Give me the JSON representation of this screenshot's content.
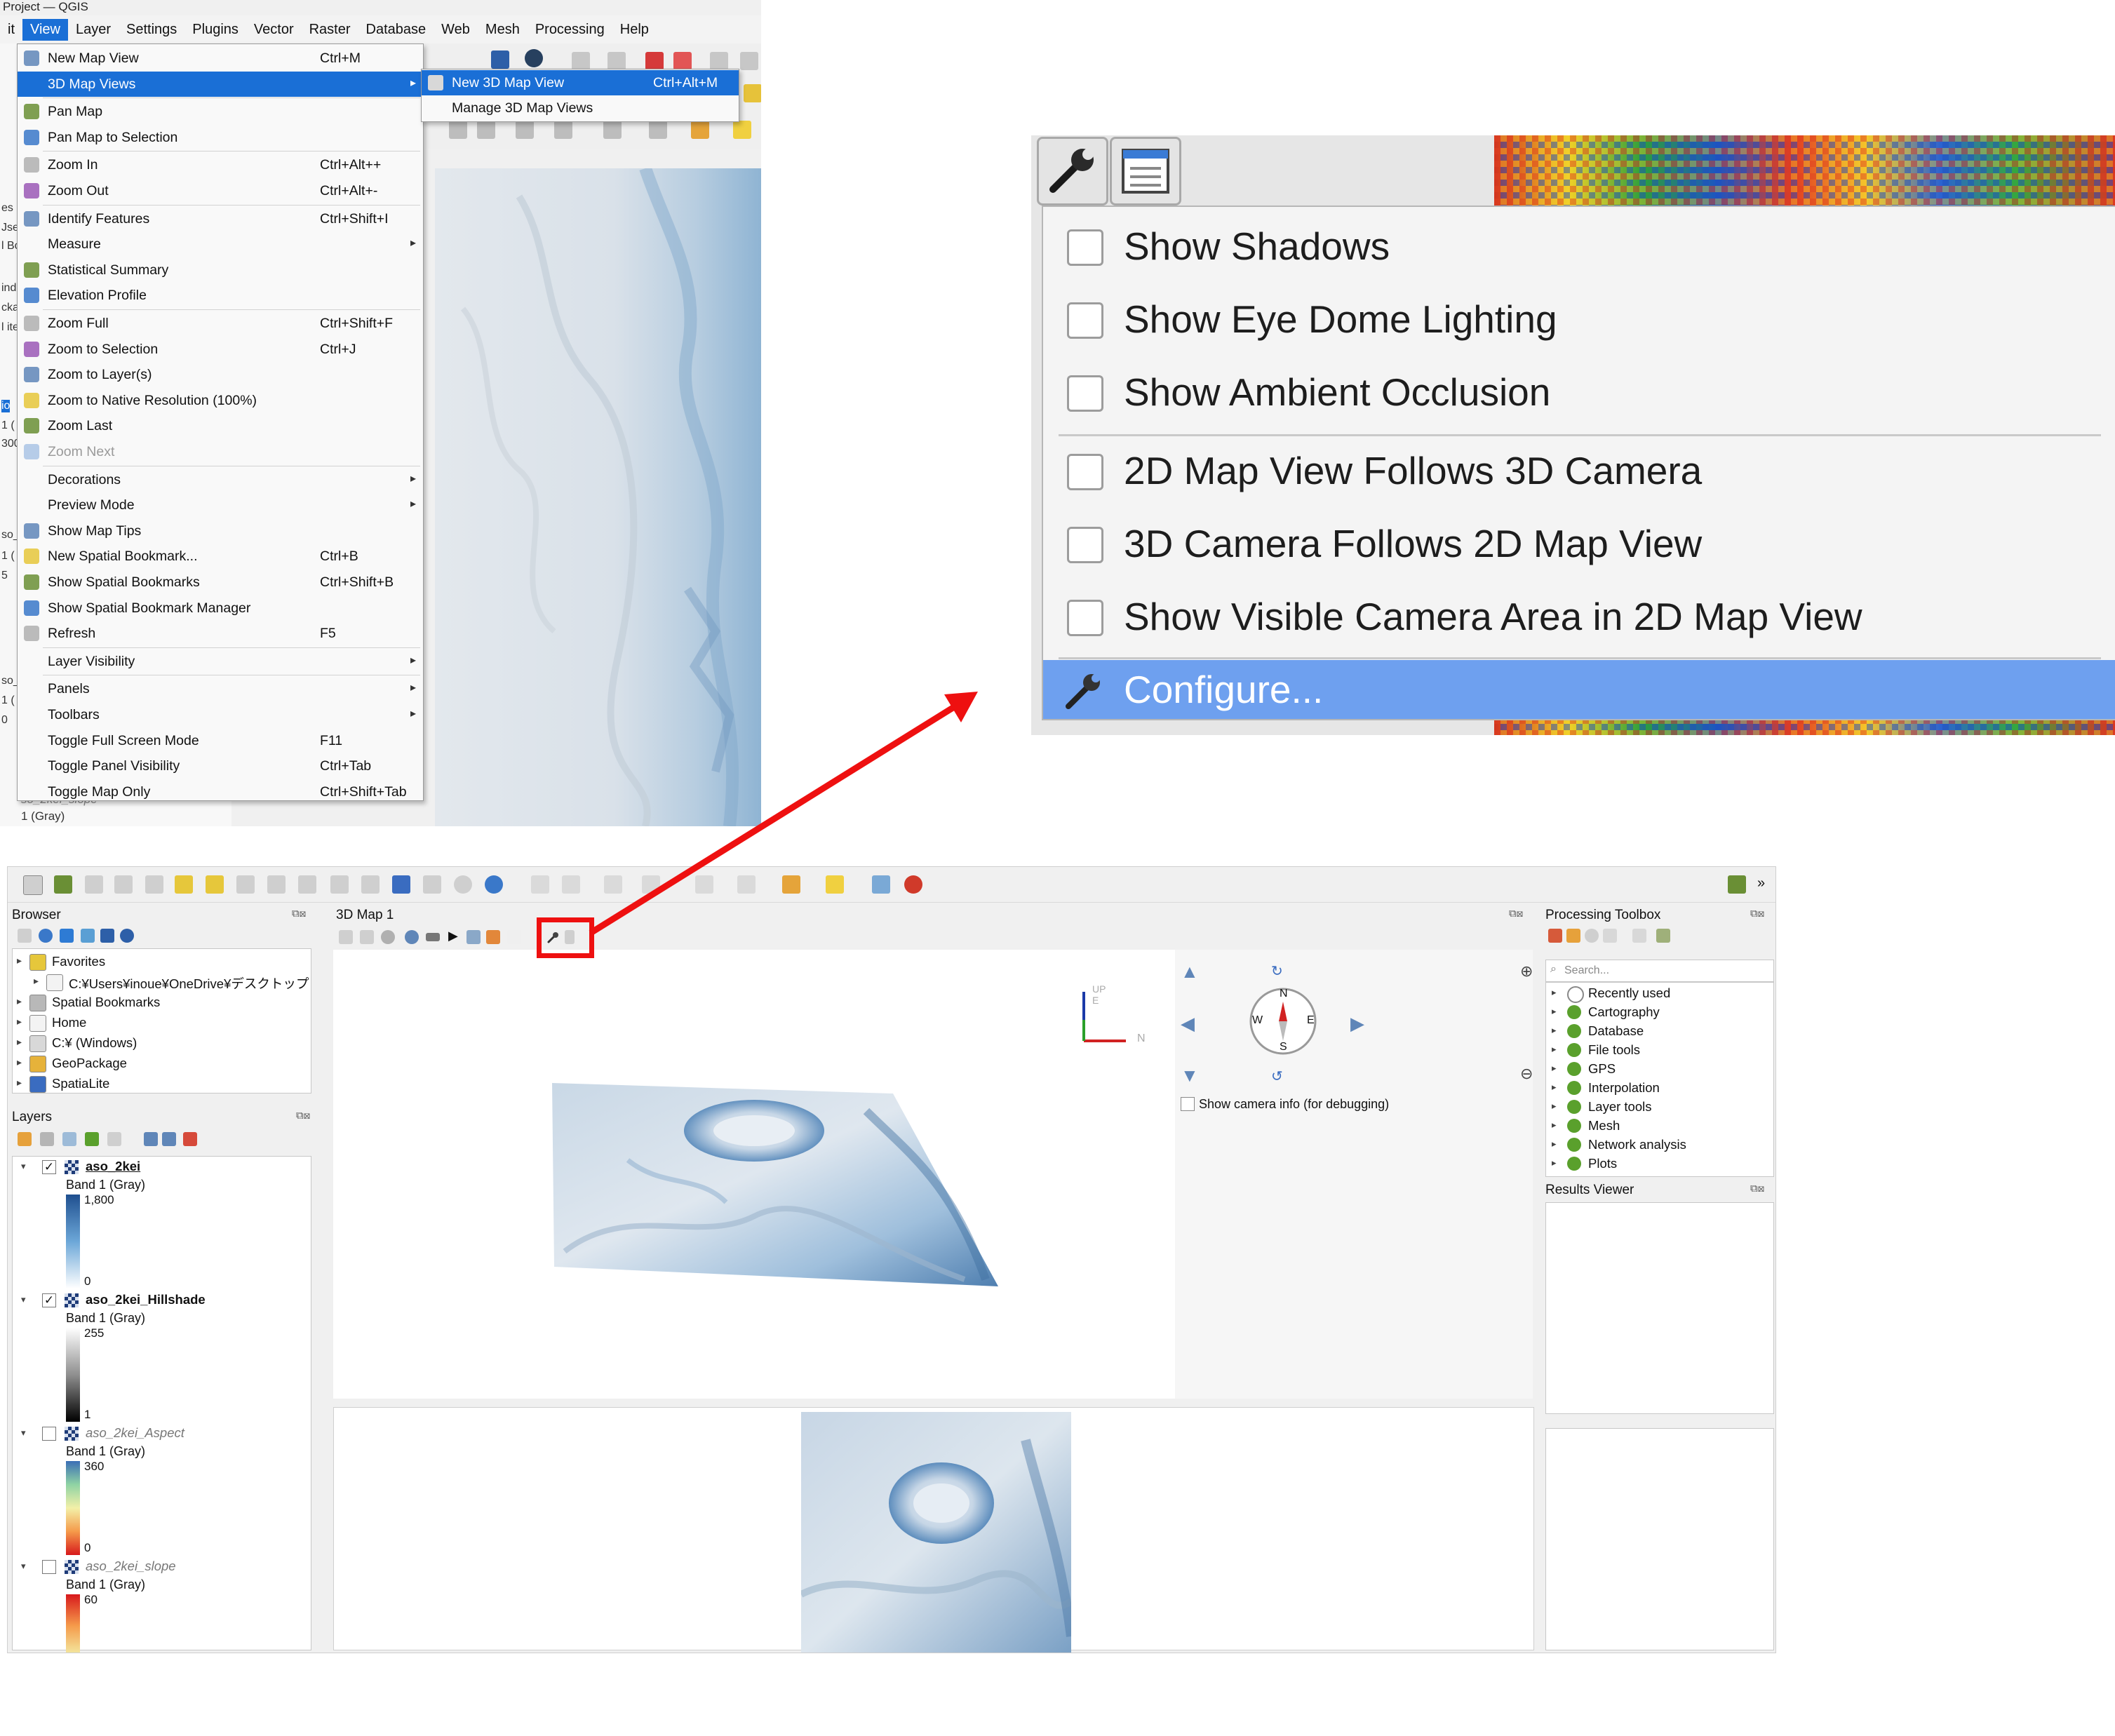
{
  "top_window": {
    "title": "Project — QGIS",
    "menubar": [
      "it",
      "View",
      "Layer",
      "Settings",
      "Plugins",
      "Vector",
      "Raster",
      "Database",
      "Web",
      "Mesh",
      "Processing",
      "Help"
    ],
    "left_fragments": [
      "es",
      "Jse",
      "l Bo",
      "ind",
      "cka",
      "l ite",
      "io",
      "1 (",
      "300",
      "so_",
      "1 (",
      "5",
      "so_",
      "1 (",
      "0"
    ],
    "under_panel": {
      "layer_name": "so_2kei_slope",
      "band": "1 (Gray)"
    },
    "view_menu": [
      {
        "label": "New Map View",
        "shortcut": "Ctrl+M",
        "icon": "new-map-view-icon"
      },
      {
        "label": "3D Map Views",
        "shortcut": "",
        "submenu": true,
        "highlighted": true,
        "icon": ""
      },
      {
        "label": "Pan Map",
        "shortcut": "",
        "icon": "pan-hand-icon"
      },
      {
        "label": "Pan Map to Selection",
        "shortcut": "",
        "icon": "pan-selection-icon"
      },
      {
        "label": "Zoom In",
        "shortcut": "Ctrl+Alt++",
        "icon": "zoom-in-icon"
      },
      {
        "label": "Zoom Out",
        "shortcut": "Ctrl+Alt+-",
        "icon": "zoom-out-icon"
      },
      {
        "label": "Identify Features",
        "shortcut": "Ctrl+Shift+I",
        "icon": "identify-icon"
      },
      {
        "label": "Measure",
        "shortcut": "",
        "submenu": true,
        "icon": ""
      },
      {
        "label": "Statistical Summary",
        "shortcut": "",
        "icon": "sigma-icon"
      },
      {
        "label": "Elevation Profile",
        "shortcut": "",
        "icon": "elevation-profile-icon"
      },
      {
        "label": "Zoom Full",
        "shortcut": "Ctrl+Shift+F",
        "icon": "zoom-full-icon"
      },
      {
        "label": "Zoom to Selection",
        "shortcut": "Ctrl+J",
        "icon": "zoom-selection-icon"
      },
      {
        "label": "Zoom to Layer(s)",
        "shortcut": "",
        "icon": "zoom-layer-icon"
      },
      {
        "label": "Zoom to Native Resolution (100%)",
        "shortcut": "",
        "icon": "zoom-native-icon"
      },
      {
        "label": "Zoom Last",
        "shortcut": "",
        "icon": "zoom-last-icon"
      },
      {
        "label": "Zoom Next",
        "shortcut": "",
        "disabled": true,
        "icon": "zoom-next-icon"
      },
      {
        "label": "Decorations",
        "shortcut": "",
        "submenu": true,
        "icon": ""
      },
      {
        "label": "Preview Mode",
        "shortcut": "",
        "submenu": true,
        "icon": ""
      },
      {
        "label": "Show Map Tips",
        "shortcut": "",
        "icon": "map-tips-icon"
      },
      {
        "label": "New Spatial Bookmark...",
        "shortcut": "Ctrl+B",
        "icon": "new-bookmark-icon"
      },
      {
        "label": "Show Spatial Bookmarks",
        "shortcut": "Ctrl+Shift+B",
        "icon": "bookmarks-icon"
      },
      {
        "label": "Show Spatial Bookmark Manager",
        "shortcut": "",
        "icon": "bookmark-manager-icon"
      },
      {
        "label": "Refresh",
        "shortcut": "F5",
        "icon": "refresh-icon"
      },
      {
        "label": "Layer Visibility",
        "shortcut": "",
        "submenu": true,
        "icon": ""
      },
      {
        "label": "Panels",
        "shortcut": "",
        "submenu": true,
        "icon": ""
      },
      {
        "label": "Toolbars",
        "shortcut": "",
        "submenu": true,
        "icon": ""
      },
      {
        "label": "Toggle Full Screen Mode",
        "shortcut": "F11",
        "icon": ""
      },
      {
        "label": "Toggle Panel Visibility",
        "shortcut": "Ctrl+Tab",
        "icon": ""
      },
      {
        "label": "Toggle Map Only",
        "shortcut": "Ctrl+Shift+Tab",
        "icon": ""
      }
    ],
    "submenu_3d": [
      {
        "label": "New 3D Map View",
        "shortcut": "Ctrl+Alt+M",
        "highlighted": true
      },
      {
        "label": "Manage 3D Map Views",
        "shortcut": ""
      }
    ]
  },
  "zoom_callout": {
    "items": [
      {
        "label": "Show Shadows",
        "checked": false
      },
      {
        "label": "Show Eye Dome Lighting",
        "checked": false
      },
      {
        "label": "Show Ambient Occlusion",
        "checked": false
      },
      {
        "label": "2D Map View Follows 3D Camera",
        "checked": false
      },
      {
        "label": "3D Camera Follows 2D Map View",
        "checked": false
      },
      {
        "label": "Show Visible Camera Area in 2D Map View",
        "checked": false
      }
    ],
    "configure_label": "Configure..."
  },
  "bottom_window": {
    "browser": {
      "title": "Browser",
      "items": [
        {
          "label": "Favorites",
          "icon": "star-icon"
        },
        {
          "label": "C:¥Users¥inoue¥OneDrive¥デスクトップ",
          "icon": "folder-icon",
          "indent": true
        },
        {
          "label": "Spatial Bookmarks",
          "icon": "bookmarks-icon"
        },
        {
          "label": "Home",
          "icon": "home-icon"
        },
        {
          "label": "C:¥ (Windows)",
          "icon": "drive-icon"
        },
        {
          "label": "GeoPackage",
          "icon": "geopackage-icon"
        },
        {
          "label": "SpatiaLite",
          "icon": "spatialite-icon"
        }
      ]
    },
    "layers": {
      "title": "Layers",
      "items": [
        {
          "name": "aso_2kei",
          "checked": true,
          "band": "Band 1 (Gray)",
          "max": "1,800",
          "min": "0",
          "ramp": "blue"
        },
        {
          "name": "aso_2kei_Hillshade",
          "checked": true,
          "band": "Band 1 (Gray)",
          "max": "255",
          "min": "1",
          "ramp": "gray"
        },
        {
          "name": "aso_2kei_Aspect",
          "checked": false,
          "band": "Band 1 (Gray)",
          "max": "360",
          "min": "0",
          "ramp": "spectral"
        },
        {
          "name": "aso_2kei_slope",
          "checked": false,
          "band": "Band 1 (Gray)",
          "max": "60",
          "min": "",
          "ramp": "slope"
        }
      ]
    },
    "map3d": {
      "title": "3D Map 1",
      "axis_labels": {
        "up": "UP",
        "north": "N",
        "east": "E"
      },
      "compass": {
        "n": "N",
        "s": "S",
        "e": "E",
        "w": "W"
      },
      "camera_info_label": "Show camera info (for debugging)"
    },
    "processing": {
      "title": "Processing Toolbox",
      "search_placeholder": "Search...",
      "items": [
        "Recently used",
        "Cartography",
        "Database",
        "File tools",
        "GPS",
        "Interpolation",
        "Layer tools",
        "Mesh",
        "Network analysis",
        "Plots"
      ],
      "results_title": "Results Viewer"
    }
  },
  "colors": {
    "menu_highlight": "#1a6fd6",
    "zoom_highlight": "#6ea0ef",
    "callout_red": "#ee1010"
  }
}
